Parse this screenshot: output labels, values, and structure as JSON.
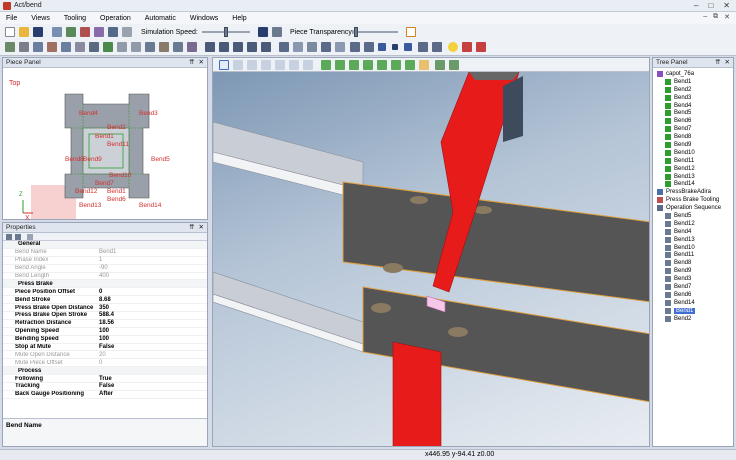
{
  "window": {
    "title": "Act/bend"
  },
  "menu": [
    "File",
    "Views",
    "Tooling",
    "Operation",
    "Automatic",
    "Windows",
    "Help"
  ],
  "toolbar": {
    "simulation_speed_label": "Simulation Speed:",
    "piece_transparency_label": "Piece Transparency:"
  },
  "piece_panel": {
    "title": "Piece Panel",
    "view_label": "Top",
    "axis_x": "X",
    "axis_z": "Z",
    "bend_labels": [
      "Bend4",
      "Bend3",
      "Bend2",
      "Bend1",
      "Bend11",
      "Bend5",
      "Bend8",
      "Bend9",
      "Bend10",
      "Bend7",
      "Bend12",
      "Bend6",
      "Bend14",
      "Bend13",
      "Bend1"
    ]
  },
  "properties": {
    "title": "Properties",
    "rows": [
      {
        "type": "cat",
        "k": "General"
      },
      {
        "type": "dis",
        "k": "Bend Name",
        "v": "Bend1"
      },
      {
        "type": "dis",
        "k": "Phase Index",
        "v": "1"
      },
      {
        "type": "dis",
        "k": "Bend Angle",
        "v": "-90"
      },
      {
        "type": "dis",
        "k": "Bend Length",
        "v": "400"
      },
      {
        "type": "cat",
        "k": "Press Brake"
      },
      {
        "type": "bold",
        "k": "Piece Position Offset",
        "v": "0"
      },
      {
        "type": "bold",
        "k": "Bend Stroke",
        "v": "8.68"
      },
      {
        "type": "bold",
        "k": "Press Brake Open Distance",
        "v": "350"
      },
      {
        "type": "bold",
        "k": "Press Brake Open Stroke",
        "v": "588.4"
      },
      {
        "type": "bold",
        "k": "Retraction Distance",
        "v": "18.56"
      },
      {
        "type": "bold",
        "k": "Opening Speed",
        "v": "100"
      },
      {
        "type": "bold",
        "k": "Bending Speed",
        "v": "100"
      },
      {
        "type": "bold",
        "k": "Stop at Mute",
        "v": "False"
      },
      {
        "type": "dis",
        "k": "Mute Open Distance",
        "v": "20"
      },
      {
        "type": "dis",
        "k": "Mute Piece Offset",
        "v": "0"
      },
      {
        "type": "cat",
        "k": "Process"
      },
      {
        "type": "bold",
        "k": "Following",
        "v": "True"
      },
      {
        "type": "bold",
        "k": "Tracking",
        "v": "False"
      },
      {
        "type": "bold",
        "k": "Back Gauge Positioning",
        "v": "After"
      }
    ],
    "description_title": "Bend Name"
  },
  "tree": {
    "title": "Tree Panel",
    "nodes": [
      {
        "label": "capot_76a",
        "level": 0,
        "icon": "part"
      },
      {
        "label": "Bend1",
        "level": 1,
        "icon": "check"
      },
      {
        "label": "Bend2",
        "level": 1,
        "icon": "check"
      },
      {
        "label": "Bend3",
        "level": 1,
        "icon": "check"
      },
      {
        "label": "Bend4",
        "level": 1,
        "icon": "check"
      },
      {
        "label": "Bend5",
        "level": 1,
        "icon": "check"
      },
      {
        "label": "Bend6",
        "level": 1,
        "icon": "check"
      },
      {
        "label": "Bend7",
        "level": 1,
        "icon": "check"
      },
      {
        "label": "Bend8",
        "level": 1,
        "icon": "check"
      },
      {
        "label": "Bend9",
        "level": 1,
        "icon": "check"
      },
      {
        "label": "Bend10",
        "level": 1,
        "icon": "check"
      },
      {
        "label": "Bend11",
        "level": 1,
        "icon": "check"
      },
      {
        "label": "Bend12",
        "level": 1,
        "icon": "check"
      },
      {
        "label": "Bend13",
        "level": 1,
        "icon": "check"
      },
      {
        "label": "Bend14",
        "level": 1,
        "icon": "check"
      },
      {
        "label": "PressBrakeAdira",
        "level": 0,
        "icon": "machine"
      },
      {
        "label": "Press Brake Tooling",
        "level": 0,
        "icon": "tool"
      },
      {
        "label": "Operation Sequence",
        "level": 0,
        "icon": "seq"
      },
      {
        "label": "Bend5",
        "level": 1,
        "icon": "op"
      },
      {
        "label": "Bend12",
        "level": 1,
        "icon": "op"
      },
      {
        "label": "Bend4",
        "level": 1,
        "icon": "op"
      },
      {
        "label": "Bend13",
        "level": 1,
        "icon": "op"
      },
      {
        "label": "Bend10",
        "level": 1,
        "icon": "op"
      },
      {
        "label": "Bend11",
        "level": 1,
        "icon": "op"
      },
      {
        "label": "Bend8",
        "level": 1,
        "icon": "op"
      },
      {
        "label": "Bend9",
        "level": 1,
        "icon": "op"
      },
      {
        "label": "Bend3",
        "level": 1,
        "icon": "op"
      },
      {
        "label": "Bend7",
        "level": 1,
        "icon": "op"
      },
      {
        "label": "Bend6",
        "level": 1,
        "icon": "op"
      },
      {
        "label": "Bend14",
        "level": 1,
        "icon": "op"
      },
      {
        "label": "Bend1",
        "level": 1,
        "icon": "op",
        "selected": true
      },
      {
        "label": "Bend2",
        "level": 1,
        "icon": "op"
      }
    ]
  },
  "status": {
    "coords": "x446.95 y-94.41 z0.00"
  },
  "colors": {
    "accent": "#3f6fd1",
    "tool_red": "#e81b1b",
    "sheet_gray": "#555555",
    "bend_orange": "#e0a040"
  }
}
